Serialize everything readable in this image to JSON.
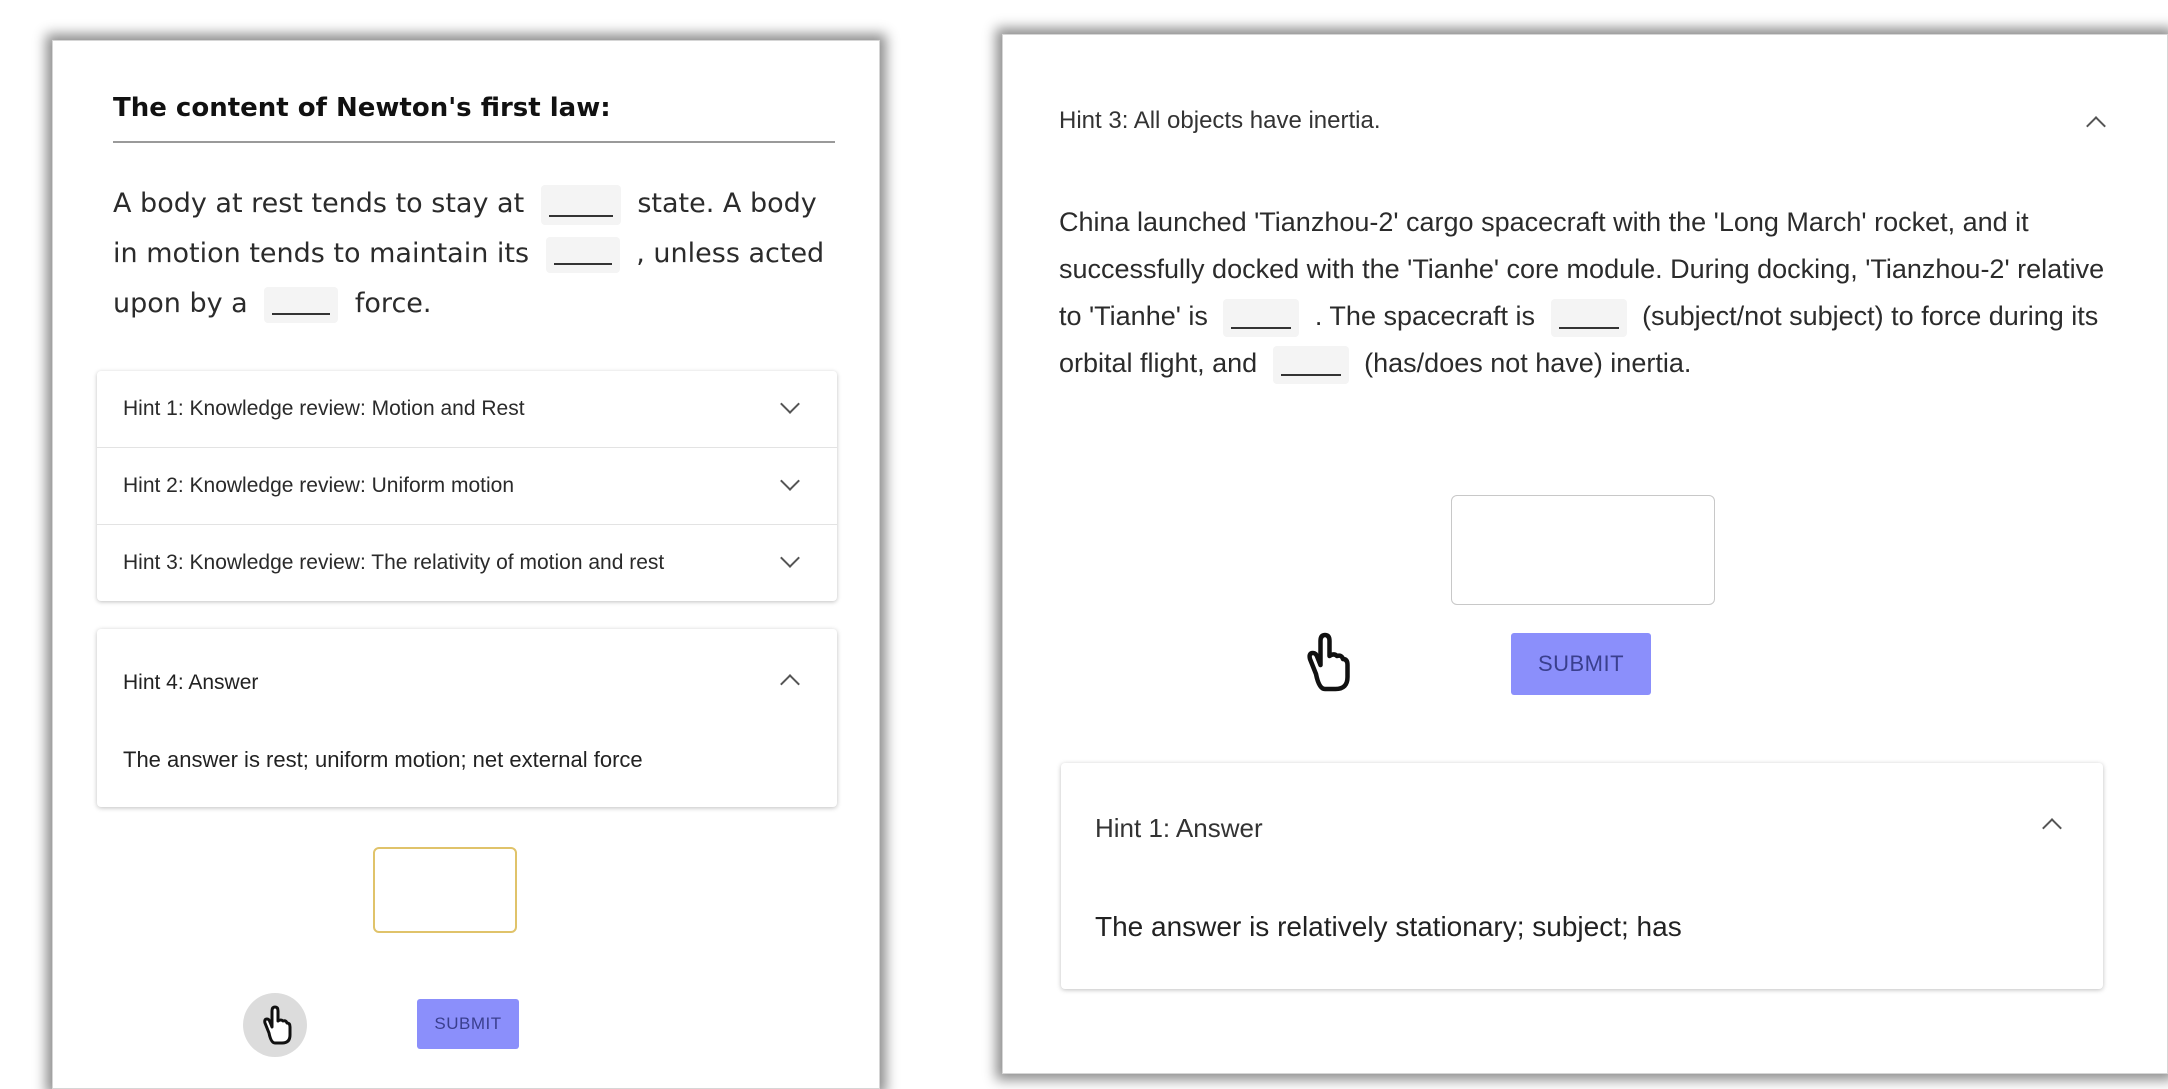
{
  "left": {
    "title": "The content of Newton's first law:",
    "question": {
      "part1": "A body at rest tends to stay at",
      "part2": "state. A body in motion tends to maintain its",
      "part3": ", unless acted upon by a",
      "part4": "force."
    },
    "hints": [
      {
        "label": "Hint 1: Knowledge review: Motion and Rest"
      },
      {
        "label": "Hint 2: Knowledge review: Uniform motion"
      },
      {
        "label": "Hint 3: Knowledge review: The relativity of motion and rest"
      }
    ],
    "hint4": {
      "label": "Hint 4: Answer",
      "body": "The answer is rest; uniform motion; net external force"
    },
    "submit_label": "SUBMIT"
  },
  "right": {
    "hint3_label": "Hint 3: All objects have inertia.",
    "question": {
      "part1": "China launched 'Tianzhou-2' cargo spacecraft with the 'Long March' rocket, and it successfully docked with the 'Tianhe' core module. During docking, 'Tianzhou-2' relative to 'Tianhe' is",
      "part2": ". The spacecraft is",
      "part3": "(subject/not subject) to force during its orbital flight, and",
      "part4": "(has/does not have) inertia."
    },
    "submit_label": "SUBMIT",
    "hint1": {
      "label": "Hint 1: Answer",
      "body": "The answer is relatively stationary; subject; has"
    }
  },
  "colors": {
    "submit_bg": "#8b8ffb",
    "input_focus_border": "#e0c36a"
  },
  "icons": [
    "chevron-down-icon",
    "chevron-up-icon",
    "hand-pointer-icon"
  ]
}
